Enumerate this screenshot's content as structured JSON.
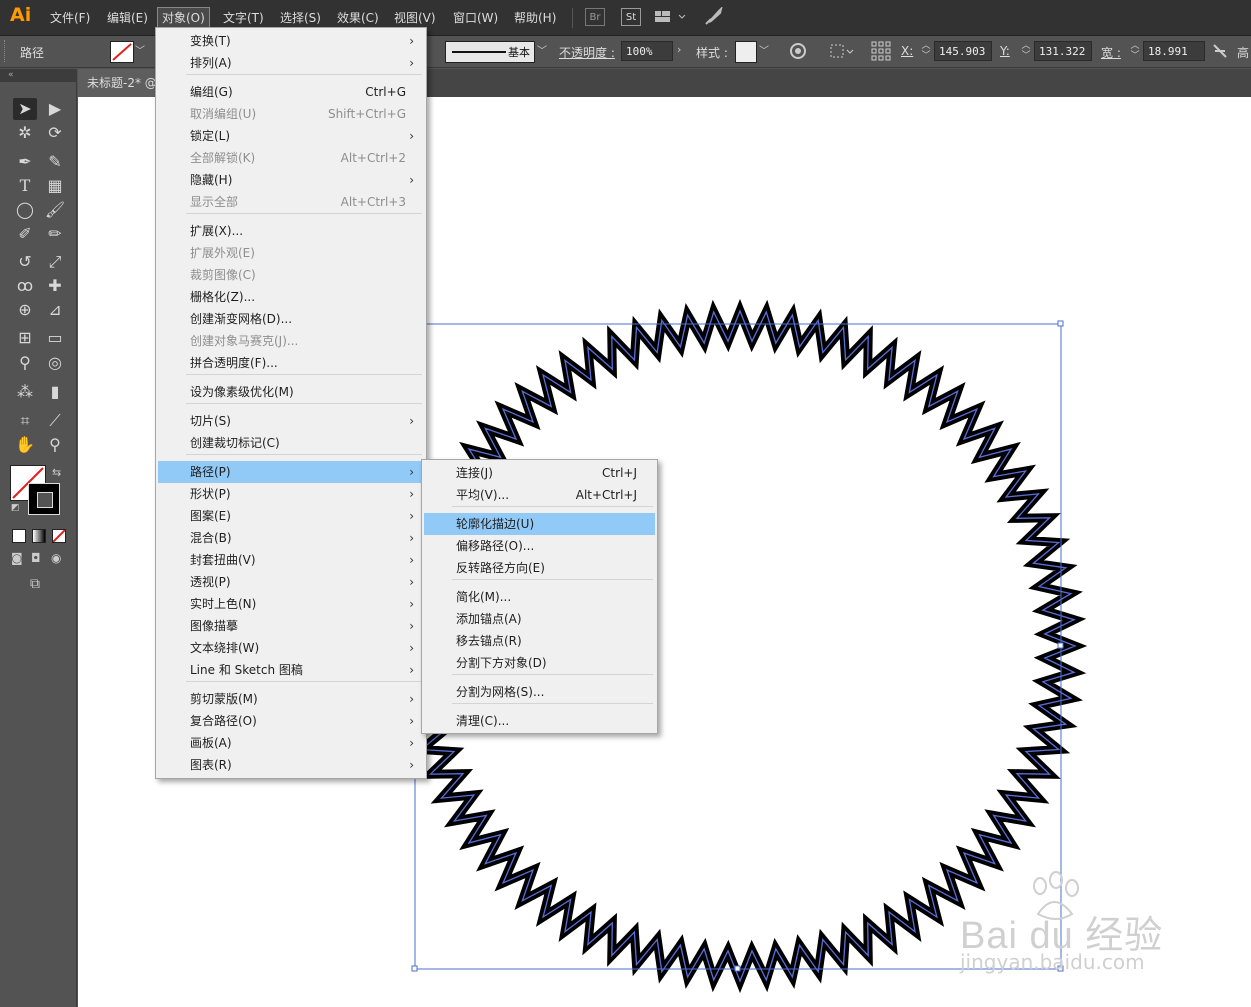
{
  "app": {
    "logo": "Ai"
  },
  "menubar": {
    "items": [
      "文件(F)",
      "编辑(E)",
      "对象(O)",
      "文字(T)",
      "选择(S)",
      "效果(C)",
      "视图(V)",
      "窗口(W)",
      "帮助(H)"
    ],
    "bridge": "Br",
    "stock": "St"
  },
  "control": {
    "path_label": "路径",
    "stroke_style": "基本",
    "opacity_label": "不透明度 :",
    "opacity_value": "100%",
    "style_label": "样式 :",
    "x_label": "X:",
    "x_value": "145.903 n",
    "y_label": "Y:",
    "y_value": "131.322 n",
    "w_label": "宽 :",
    "w_value": "18.991 mm",
    "h_label": "高"
  },
  "document": {
    "tab_title": "未标题-2* @"
  },
  "object_menu": {
    "items": [
      {
        "label": "变换(T)",
        "shortcut": "",
        "arrow": true,
        "disabled": false
      },
      {
        "label": "排列(A)",
        "shortcut": "",
        "arrow": true,
        "disabled": false
      },
      {
        "label": "编组(G)",
        "shortcut": "Ctrl+G",
        "arrow": false,
        "disabled": false
      },
      {
        "label": "取消编组(U)",
        "shortcut": "Shift+Ctrl+G",
        "arrow": false,
        "disabled": true
      },
      {
        "label": "锁定(L)",
        "shortcut": "",
        "arrow": true,
        "disabled": false
      },
      {
        "label": "全部解锁(K)",
        "shortcut": "Alt+Ctrl+2",
        "arrow": false,
        "disabled": true
      },
      {
        "label": "隐藏(H)",
        "shortcut": "",
        "arrow": true,
        "disabled": false
      },
      {
        "label": "显示全部",
        "shortcut": "Alt+Ctrl+3",
        "arrow": false,
        "disabled": true
      },
      {
        "label": "扩展(X)...",
        "shortcut": "",
        "arrow": false,
        "disabled": false
      },
      {
        "label": "扩展外观(E)",
        "shortcut": "",
        "arrow": false,
        "disabled": true
      },
      {
        "label": "裁剪图像(C)",
        "shortcut": "",
        "arrow": false,
        "disabled": true
      },
      {
        "label": "栅格化(Z)...",
        "shortcut": "",
        "arrow": false,
        "disabled": false
      },
      {
        "label": "创建渐变网格(D)...",
        "shortcut": "",
        "arrow": false,
        "disabled": false
      },
      {
        "label": "创建对象马赛克(J)...",
        "shortcut": "",
        "arrow": false,
        "disabled": true
      },
      {
        "label": "拼合透明度(F)...",
        "shortcut": "",
        "arrow": false,
        "disabled": false
      },
      {
        "label": "设为像素级优化(M)",
        "shortcut": "",
        "arrow": false,
        "disabled": false
      },
      {
        "label": "切片(S)",
        "shortcut": "",
        "arrow": true,
        "disabled": false
      },
      {
        "label": "创建裁切标记(C)",
        "shortcut": "",
        "arrow": false,
        "disabled": false
      },
      {
        "label": "路径(P)",
        "shortcut": "",
        "arrow": true,
        "disabled": false,
        "highlighted": true
      },
      {
        "label": "形状(P)",
        "shortcut": "",
        "arrow": true,
        "disabled": false
      },
      {
        "label": "图案(E)",
        "shortcut": "",
        "arrow": true,
        "disabled": false
      },
      {
        "label": "混合(B)",
        "shortcut": "",
        "arrow": true,
        "disabled": false
      },
      {
        "label": "封套扭曲(V)",
        "shortcut": "",
        "arrow": true,
        "disabled": false
      },
      {
        "label": "透视(P)",
        "shortcut": "",
        "arrow": true,
        "disabled": false
      },
      {
        "label": "实时上色(N)",
        "shortcut": "",
        "arrow": true,
        "disabled": false
      },
      {
        "label": "图像描摹",
        "shortcut": "",
        "arrow": true,
        "disabled": false
      },
      {
        "label": "文本绕排(W)",
        "shortcut": "",
        "arrow": true,
        "disabled": false
      },
      {
        "label": "Line 和 Sketch 图稿",
        "shortcut": "",
        "arrow": true,
        "disabled": false
      },
      {
        "label": "剪切蒙版(M)",
        "shortcut": "",
        "arrow": true,
        "disabled": false
      },
      {
        "label": "复合路径(O)",
        "shortcut": "",
        "arrow": true,
        "disabled": false
      },
      {
        "label": "画板(A)",
        "shortcut": "",
        "arrow": true,
        "disabled": false
      },
      {
        "label": "图表(R)",
        "shortcut": "",
        "arrow": true,
        "disabled": false
      }
    ]
  },
  "path_submenu": {
    "items": [
      {
        "label": "连接(J)",
        "shortcut": "Ctrl+J"
      },
      {
        "label": "平均(V)...",
        "shortcut": "Alt+Ctrl+J"
      },
      {
        "label": "轮廓化描边(U)",
        "shortcut": "",
        "highlighted": true
      },
      {
        "label": "偏移路径(O)...",
        "shortcut": ""
      },
      {
        "label": "反转路径方向(E)",
        "shortcut": ""
      },
      {
        "label": "简化(M)...",
        "shortcut": ""
      },
      {
        "label": "添加锚点(A)",
        "shortcut": ""
      },
      {
        "label": "移去锚点(R)",
        "shortcut": ""
      },
      {
        "label": "分割下方对象(D)",
        "shortcut": ""
      },
      {
        "label": "分割为网格(S)...",
        "shortcut": ""
      },
      {
        "label": "清理(C)...",
        "shortcut": ""
      }
    ]
  },
  "watermark": {
    "brand": "Bai du 经验",
    "url": "jingyan.baidu.com"
  },
  "colors": {
    "highlight": "#91c9f7",
    "selection": "#4a6fd1",
    "logo": "#ff9a00"
  }
}
